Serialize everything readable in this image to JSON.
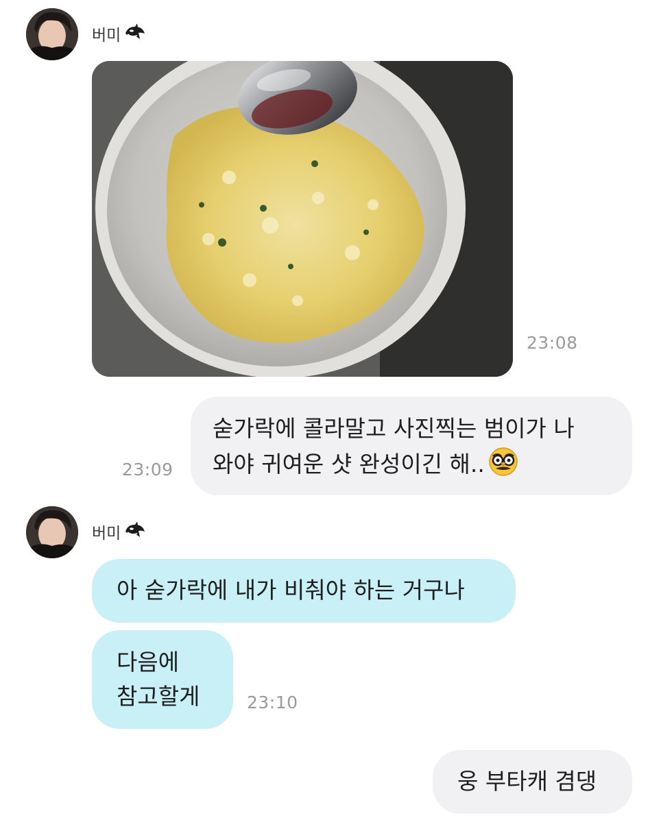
{
  "chat": {
    "sender": {
      "name": "버미",
      "badge_icon": "orca-emoji-icon",
      "avatar": "user-avatar-photo"
    },
    "messages": [
      {
        "from": "them",
        "type": "photo",
        "image": "fried-rice-bowl-with-spoon",
        "time": "23:08"
      },
      {
        "from": "me",
        "type": "text",
        "lines": [
          "숟가락에 콜라말고 사진찍는 범이가 나",
          "와야 귀여운 샷 완성이긴 해.."
        ],
        "emoji": "disguised-face-emoji-icon",
        "time": "23:09"
      },
      {
        "from": "them",
        "type": "text",
        "text": "아 숟가락에 내가 비춰야 하는 거구나"
      },
      {
        "from": "them",
        "type": "text",
        "lines": [
          "다음에",
          "참고할게"
        ],
        "time": "23:10"
      },
      {
        "from": "me",
        "type": "text",
        "text": "웅 부타캐 겸댕"
      }
    ]
  },
  "colors": {
    "my_bubble": "#f1f1f4",
    "their_bubble": "#c9f0f6",
    "timestamp": "#9a9a9a",
    "background": "#ffffff"
  }
}
